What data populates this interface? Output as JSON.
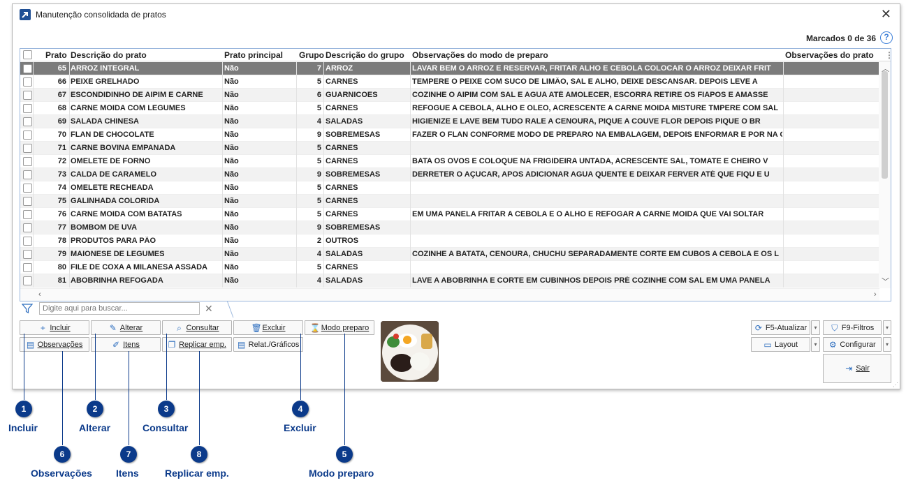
{
  "window": {
    "title": "Manutenção consolidada de pratos",
    "marked_label": "Marcados 0 de 36",
    "help": "?"
  },
  "grid": {
    "columns": [
      "Prato",
      "Descrição do prato",
      "Prato principal",
      "Grupo",
      "Descrição do grupo",
      "Observações do modo de preparo",
      "Observações do prato"
    ],
    "rows": [
      {
        "prato": "65",
        "descricao": "ARROZ INTEGRAL",
        "principal": "Não",
        "grupo": "7",
        "grupo_desc": "ARROZ",
        "obs": "LAVAR BEM O ARROZ E RESERVAR, FRITAR ALHO E CEBOLA COLOCAR O ARROZ DEIXAR FRIT"
      },
      {
        "prato": "66",
        "descricao": "PEIXE GRELHADO",
        "principal": "Não",
        "grupo": "5",
        "grupo_desc": "CARNES",
        "obs": "TEMPERE O PEIXE COM SUCO DE LIMÃO, SAL E ALHO, DEIXE DESCANSAR. DEPOIS LEVE A"
      },
      {
        "prato": "67",
        "descricao": "ESCONDIDINHO DE AIPIM E CARNE",
        "principal": "Não",
        "grupo": "6",
        "grupo_desc": "GUARNICOES",
        "obs": "COZINHE O AIPIM COM SAL E AGUA ATÉ AMOLECER, ESCORRA RETIRE OS FIAPOS E AMASSE"
      },
      {
        "prato": "68",
        "descricao": "CARNE MOIDA COM LEGUMES",
        "principal": "Não",
        "grupo": "5",
        "grupo_desc": "CARNES",
        "obs": "REFOGUE A CEBOLA, ALHO E OLEO, ACRESCENTE A CARNE MOIDA MISTURE TMPERE COM SAL"
      },
      {
        "prato": "69",
        "descricao": "SALADA CHINESA",
        "principal": "Não",
        "grupo": "4",
        "grupo_desc": "SALADAS",
        "obs": "HIGIENIZE E LAVE BEM TUDO RALE A CENOURA, PIQUE A COUVE FLOR DEPOIS PIQUE O BR"
      },
      {
        "prato": "70",
        "descricao": "FLAN DE CHOCOLATE",
        "principal": "Não",
        "grupo": "9",
        "grupo_desc": "SOBREMESAS",
        "obs": "FAZER O FLAN CONFORME MODO DE PREPARO NA EMBALAGEM, DEPOIS ENFORMAR E POR NA G"
      },
      {
        "prato": "71",
        "descricao": "CARNE BOVINA EMPANADA",
        "principal": "Não",
        "grupo": "5",
        "grupo_desc": "CARNES",
        "obs": ""
      },
      {
        "prato": "72",
        "descricao": "OMELETE DE FORNO",
        "principal": "Não",
        "grupo": "5",
        "grupo_desc": "CARNES",
        "obs": "BATA OS OVOS E COLOQUE NA FRIGIDEIRA UNTADA, ACRESCENTE SAL, TOMATE E CHEIRO V"
      },
      {
        "prato": "73",
        "descricao": "CALDA DE CARAMELO",
        "principal": "Não",
        "grupo": "9",
        "grupo_desc": "SOBREMESAS",
        "obs": "DERRETER O AÇUCAR, APOS ADICIONAR AGUA QUENTE E DEIXAR FERVER ATÉ QUE FIQU E U"
      },
      {
        "prato": "74",
        "descricao": "OMELETE RECHEADA",
        "principal": "Não",
        "grupo": "5",
        "grupo_desc": "CARNES",
        "obs": ""
      },
      {
        "prato": "75",
        "descricao": "GALINHADA COLORIDA",
        "principal": "Não",
        "grupo": "5",
        "grupo_desc": "CARNES",
        "obs": ""
      },
      {
        "prato": "76",
        "descricao": "CARNE MOIDA COM BATATAS",
        "principal": "Não",
        "grupo": "5",
        "grupo_desc": "CARNES",
        "obs": "EM UMA PANELA FRITAR A CEBOLA E O ALHO E REFOGAR A CARNE MOIDA QUE VAI SOLTAR"
      },
      {
        "prato": "77",
        "descricao": "BOMBOM DE UVA",
        "principal": "Não",
        "grupo": "9",
        "grupo_desc": "SOBREMESAS",
        "obs": ""
      },
      {
        "prato": "78",
        "descricao": "PRODUTOS PARA PÃO",
        "principal": "Não",
        "grupo": "2",
        "grupo_desc": "OUTROS",
        "obs": ""
      },
      {
        "prato": "79",
        "descricao": "MAIONESE DE LEGUMES",
        "principal": "Não",
        "grupo": "4",
        "grupo_desc": "SALADAS",
        "obs": "COZINHE A BATATA, CENOURA, CHUCHU SEPARADAMENTE CORTE EM CUBOS A CEBOLA E OS L"
      },
      {
        "prato": "80",
        "descricao": "FILE DE COXA A MILANESA ASSADA",
        "principal": "Não",
        "grupo": "5",
        "grupo_desc": "CARNES",
        "obs": ""
      },
      {
        "prato": "81",
        "descricao": "ABOBRINHA REFOGADA",
        "principal": "Não",
        "grupo": "4",
        "grupo_desc": "SALADAS",
        "obs": "LAVE A ABOBRINHA E CORTE EM CUBINHOS DEPOIS PRÉ COZINHE COM SAL EM UMA PANELA"
      }
    ]
  },
  "search": {
    "placeholder": "Digite aqui para buscar..."
  },
  "buttons": {
    "incluir": "Incluir",
    "alterar": "Alterar",
    "consultar": "Consultar",
    "excluir": "Excluir",
    "modo_preparo": "Modo preparo",
    "observacoes": "Observações",
    "itens": "Itens",
    "replicar": "Replicar emp.",
    "relat": "Relat./Gráficos",
    "atualizar": "F5-Atualizar",
    "filtros": "F9-Filtros",
    "layout": "Layout",
    "configurar": "Configurar",
    "sair": "Sair"
  },
  "callouts": [
    {
      "num": "1",
      "label": "Incluir"
    },
    {
      "num": "2",
      "label": "Alterar"
    },
    {
      "num": "3",
      "label": "Consultar"
    },
    {
      "num": "4",
      "label": "Excluir"
    },
    {
      "num": "5",
      "label": "Modo preparo"
    },
    {
      "num": "6",
      "label": "Observações"
    },
    {
      "num": "7",
      "label": "Itens"
    },
    {
      "num": "8",
      "label": "Replicar emp."
    }
  ],
  "colors": {
    "accent": "#0b3a8a",
    "selected_row": "#7b7b7b",
    "icon_blue": "#2f6fbf"
  }
}
